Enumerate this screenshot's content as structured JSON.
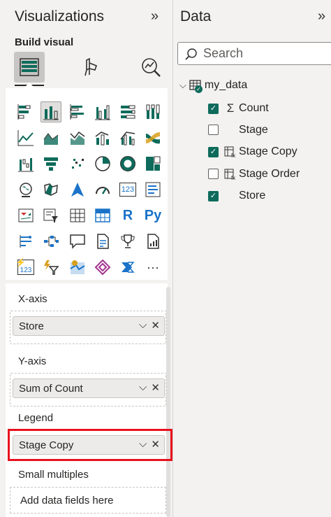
{
  "visualizations": {
    "title": "Visualizations",
    "build_visual_label": "Build visual",
    "wells": {
      "xaxis": {
        "label": "X-axis",
        "field": "Store"
      },
      "yaxis": {
        "label": "Y-axis",
        "field": "Sum of Count"
      },
      "legend": {
        "label": "Legend",
        "field": "Stage Copy"
      },
      "small_multiples": {
        "label": "Small multiples",
        "placeholder": "Add data fields here"
      }
    },
    "gallery_text": {
      "r": "R",
      "py": "Py",
      "card_num": "123",
      "more": "···"
    }
  },
  "data": {
    "title": "Data",
    "search_placeholder": "Search",
    "table": "my_data",
    "fields": [
      {
        "name": "Count",
        "checked": true,
        "icon": "sigma-icon"
      },
      {
        "name": "Stage",
        "checked": false,
        "icon": ""
      },
      {
        "name": "Stage Copy",
        "checked": true,
        "icon": "calculated-column-icon"
      },
      {
        "name": "Stage Order",
        "checked": false,
        "icon": "calculated-column-icon"
      },
      {
        "name": "Store",
        "checked": true,
        "icon": ""
      }
    ]
  },
  "colors": {
    "accent": "#0e6b5b",
    "highlight": "#e8121d"
  }
}
